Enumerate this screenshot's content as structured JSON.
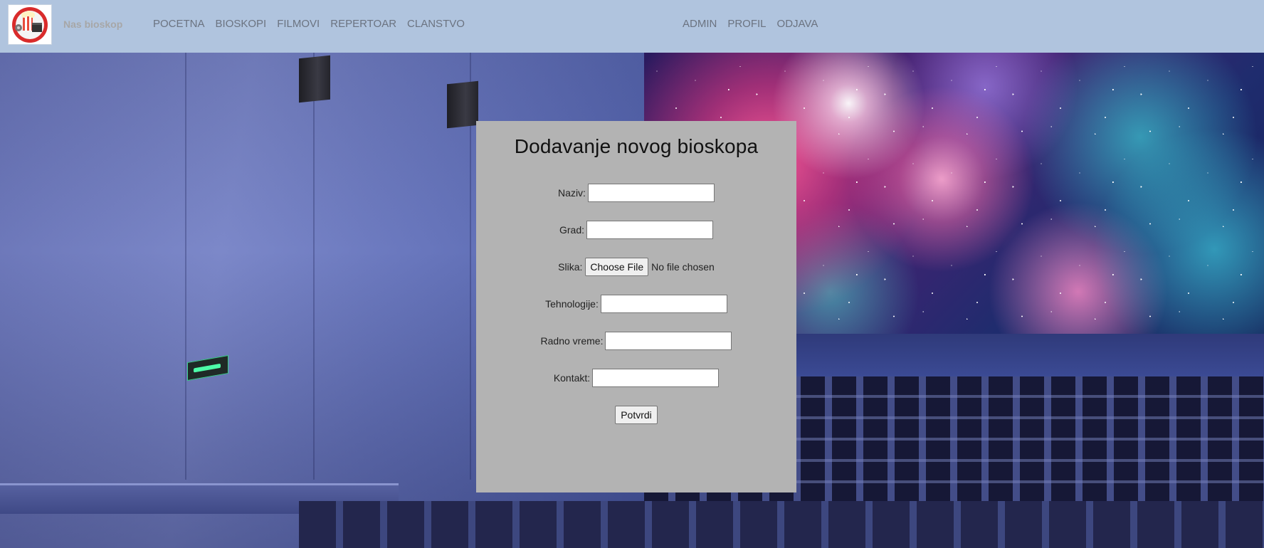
{
  "navbar": {
    "brand": "Nas bioskop",
    "logo_icon": "cinema-popcorn-logo",
    "links_left": [
      "POCETNA",
      "BIOSKOPI",
      "FILMOVI",
      "REPERTOAR",
      "CLANSTVO"
    ],
    "links_right": [
      "ADMIN",
      "PROFIL",
      "ODJAVA"
    ],
    "background_color": "#b0c4de"
  },
  "form": {
    "title": "Dodavanje novog bioskopa",
    "background_color": "#b3b3b3",
    "naziv": {
      "label": "Naziv:",
      "value": ""
    },
    "grad": {
      "label": "Grad:",
      "value": ""
    },
    "slika": {
      "label": "Slika:",
      "button": "Choose File",
      "status": "No file chosen"
    },
    "tehnologije": {
      "label": "Tehnologije:",
      "value": ""
    },
    "radno_vreme": {
      "label": "Radno vreme:",
      "value": ""
    },
    "kontakt": {
      "label": "Kontakt:",
      "value": ""
    },
    "submit": "Potvrdi"
  }
}
